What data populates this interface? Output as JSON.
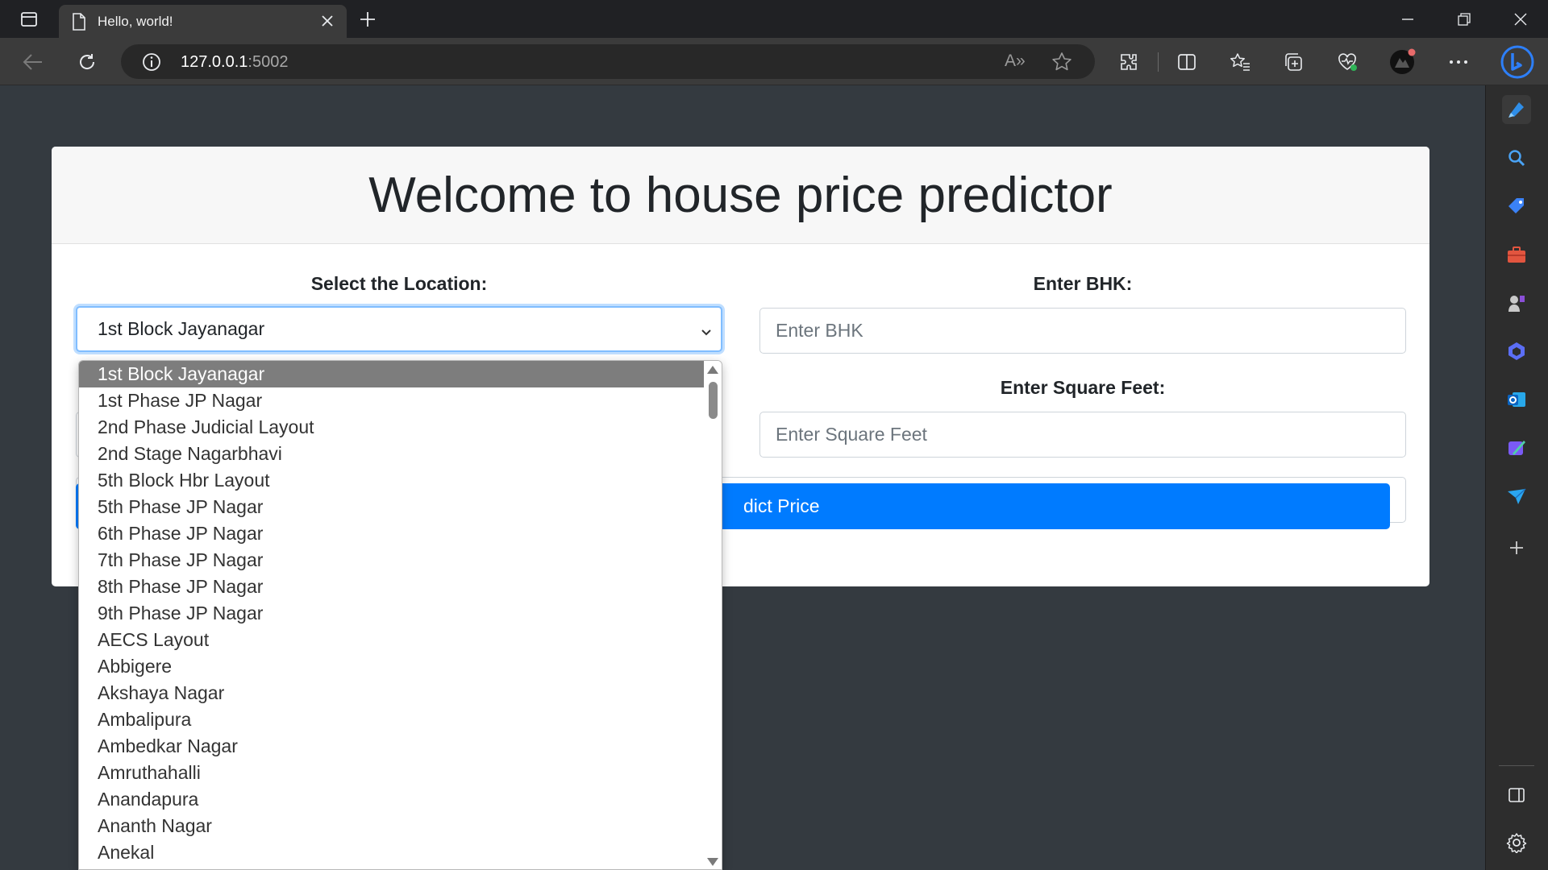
{
  "browser": {
    "tab_title": "Hello, world!",
    "url_host": "127.0.0.1",
    "url_port": ":5002",
    "read_aloud_glyph": "A»"
  },
  "page": {
    "title": "Welcome to house price predictor",
    "location_label": "Select the Location:",
    "location_value": "1st Block Jayanagar",
    "bhk_label": "Enter BHK:",
    "bhk_placeholder": "Enter BHK",
    "sqft_label": "Enter Square Feet:",
    "sqft_placeholder": "Enter Square Feet",
    "predict_visible_label": "dict Price"
  },
  "dropdown": {
    "selected": "1st Block Jayanagar",
    "options": [
      "1st Block Jayanagar",
      "1st Phase JP Nagar",
      "2nd Phase Judicial Layout",
      "2nd Stage Nagarbhavi",
      "5th Block Hbr Layout",
      "5th Phase JP Nagar",
      "6th Phase JP Nagar",
      "7th Phase JP Nagar",
      "8th Phase JP Nagar",
      "9th Phase JP Nagar",
      "AECS Layout",
      "Abbigere",
      "Akshaya Nagar",
      "Ambalipura",
      "Ambedkar Nagar",
      "Amruthahalli",
      "Anandapura",
      "Ananth Nagar",
      "Anekal"
    ]
  },
  "colors": {
    "page_bg": "#343a40",
    "primary": "#007bff",
    "focus_ring": "#80bdff",
    "selected_option_bg": "#7d7d7d"
  }
}
